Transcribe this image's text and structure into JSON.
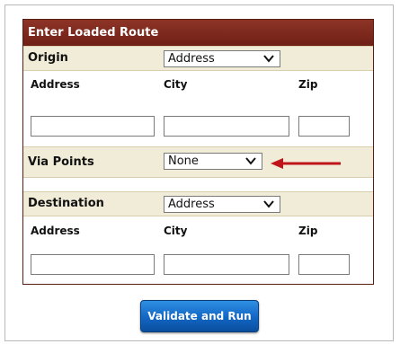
{
  "panel": {
    "title": "Enter Loaded Route"
  },
  "origin": {
    "label": "Origin",
    "select_value": "Address",
    "columns": {
      "address": "Address",
      "city": "City",
      "zip": "Zip"
    },
    "values": {
      "address": "",
      "city": "",
      "zip": ""
    }
  },
  "via": {
    "label": "Via Points",
    "select_value": "None"
  },
  "destination": {
    "label": "Destination",
    "select_value": "Address",
    "columns": {
      "address": "Address",
      "city": "City",
      "zip": "Zip"
    },
    "values": {
      "address": "",
      "city": "",
      "zip": ""
    }
  },
  "actions": {
    "validate_label": "Validate and Run"
  },
  "icons": {
    "dropdown": "chevron-down-icon",
    "annotation": "arrow-left-icon"
  },
  "colors": {
    "header_bg": "#7a2a1e",
    "row_bg": "#f0ecd7",
    "arrow": "#c0141b",
    "button": "#1266c4"
  }
}
